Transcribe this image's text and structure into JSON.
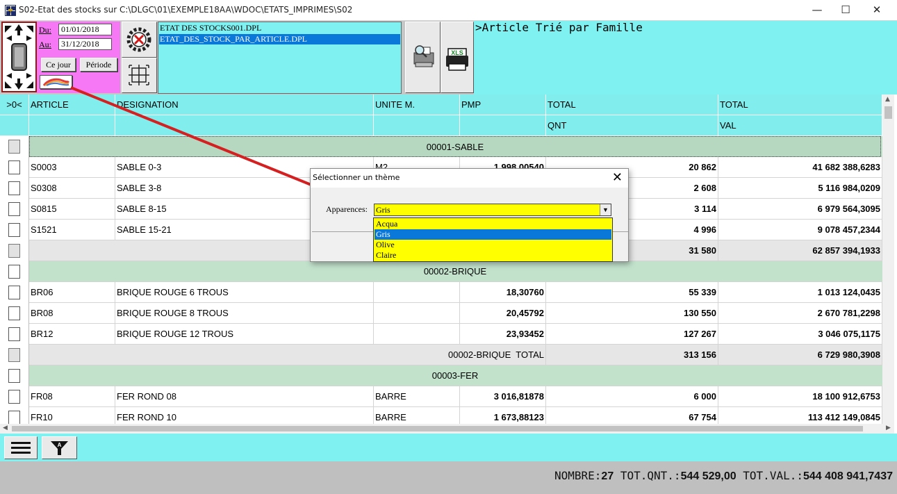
{
  "window": {
    "title": "S02-Etat des stocks sur C:\\DLGC\\01\\EXEMPLE18AA\\WDOC\\ETATS_IMPRIMES\\S02",
    "minimize": "—",
    "maximize": "☐",
    "close": "✕"
  },
  "dates": {
    "from_label": "Du:",
    "from_value": "01/01/2018",
    "to_label": "Au:",
    "to_value": "31/12/2018",
    "today_button": "Ce jour",
    "period_button": "Période"
  },
  "report_list": {
    "items": [
      "ETAT DES STOCKS001.DPL",
      "ETAT_DES_STOCK_PAR_ARTICLE.DPL"
    ],
    "selected_index": 1
  },
  "report_title": ">Article Trié par Famille",
  "table": {
    "columns": [
      "ARTICLE",
      "DESIGNATION",
      "UNITE M.",
      "PMP",
      "TOTAL",
      "TOTAL"
    ],
    "subcolumns": [
      "",
      "",
      "",
      "",
      "QNT",
      "VAL"
    ],
    "select_header": ">0<",
    "rows": [
      {
        "type": "family",
        "label": "00001-SABLE"
      },
      {
        "type": "item",
        "article": "S0003",
        "designation": "SABLE 0-3",
        "unit": "M2",
        "pmp": "1 998,00540",
        "qnt": "20 862",
        "val": "41 682 388,6283"
      },
      {
        "type": "item",
        "article": "S0308",
        "designation": "SABLE 3-8",
        "unit": "",
        "pmp": "",
        "qnt": "2 608",
        "val": "5 116 984,0209"
      },
      {
        "type": "item",
        "article": "S0815",
        "designation": "SABLE 8-15",
        "unit": "",
        "pmp": "",
        "qnt": "3 114",
        "val": "6 979 564,3095"
      },
      {
        "type": "item",
        "article": "S1521",
        "designation": "SABLE 15-21",
        "unit": "",
        "pmp": "",
        "qnt": "4 996",
        "val": "9 078 457,2344"
      },
      {
        "type": "total",
        "label": "",
        "qnt": "31 580",
        "val": "62 857 394,1933"
      },
      {
        "type": "family",
        "label": "00002-BRIQUE"
      },
      {
        "type": "item",
        "article": "BR06",
        "designation": "BRIQUE ROUGE 6 TROUS",
        "unit": "",
        "pmp": "18,30760",
        "qnt": "55 339",
        "val": "1 013 124,0435"
      },
      {
        "type": "item",
        "article": "BR08",
        "designation": "BRIQUE ROUGE 8 TROUS",
        "unit": "",
        "pmp": "20,45792",
        "qnt": "130 550",
        "val": "2 670 781,2298"
      },
      {
        "type": "item",
        "article": "BR12",
        "designation": "BRIQUE ROUGE 12 TROUS",
        "unit": "",
        "pmp": "23,93452",
        "qnt": "127 267",
        "val": "3 046 075,1175"
      },
      {
        "type": "total",
        "label": "00002-BRIQUE  TOTAL",
        "qnt": "313 156",
        "val": "6 729 980,3908"
      },
      {
        "type": "family",
        "label": "00003-FER"
      },
      {
        "type": "item",
        "article": "FR08",
        "designation": "FER ROND 08",
        "unit": "BARRE",
        "pmp": "3 016,81878",
        "qnt": "6 000",
        "val": "18 100 912,6753"
      },
      {
        "type": "item",
        "article": "FR10",
        "designation": "FER ROND 10",
        "unit": "BARRE",
        "pmp": "1 673,88123",
        "qnt": "67 754",
        "val": "113 412 149,0845"
      }
    ]
  },
  "status": {
    "count_label": "NOMBRE:",
    "count_value": "27",
    "qnt_label": "TOT.QNT.:",
    "qnt_value": "544 529,00",
    "val_label": "TOT.VAL.:",
    "val_value": "544 408 941,7437"
  },
  "dialog": {
    "title": "Sélectionner un thème",
    "close": "✕",
    "label": "Apparences:",
    "selected_value": "Gris",
    "options": [
      "Acqua",
      "Gris",
      "Olive",
      "Claire"
    ],
    "highlighted_index": 1
  },
  "colors": {
    "cyan_panel": "#7ff1f1",
    "header_cyan": "#81eded",
    "date_panel_pink": "#f678f4",
    "family_row_green": "#c2e2cc",
    "total_row_grey": "#e6e6e6",
    "combo_yellow": "#ffff00",
    "selection_blue": "#0a78d8",
    "annotation_arrow_red": "#d42020"
  },
  "icons": [
    "app-icon",
    "navigation-arrows-icon",
    "color-palette-icon",
    "settings-stop-icon",
    "crosshair-icon",
    "print-preview-icon",
    "xls-print-icon",
    "menu-hamburger-icon",
    "filter-icon",
    "dropdown-arrow-icon"
  ]
}
